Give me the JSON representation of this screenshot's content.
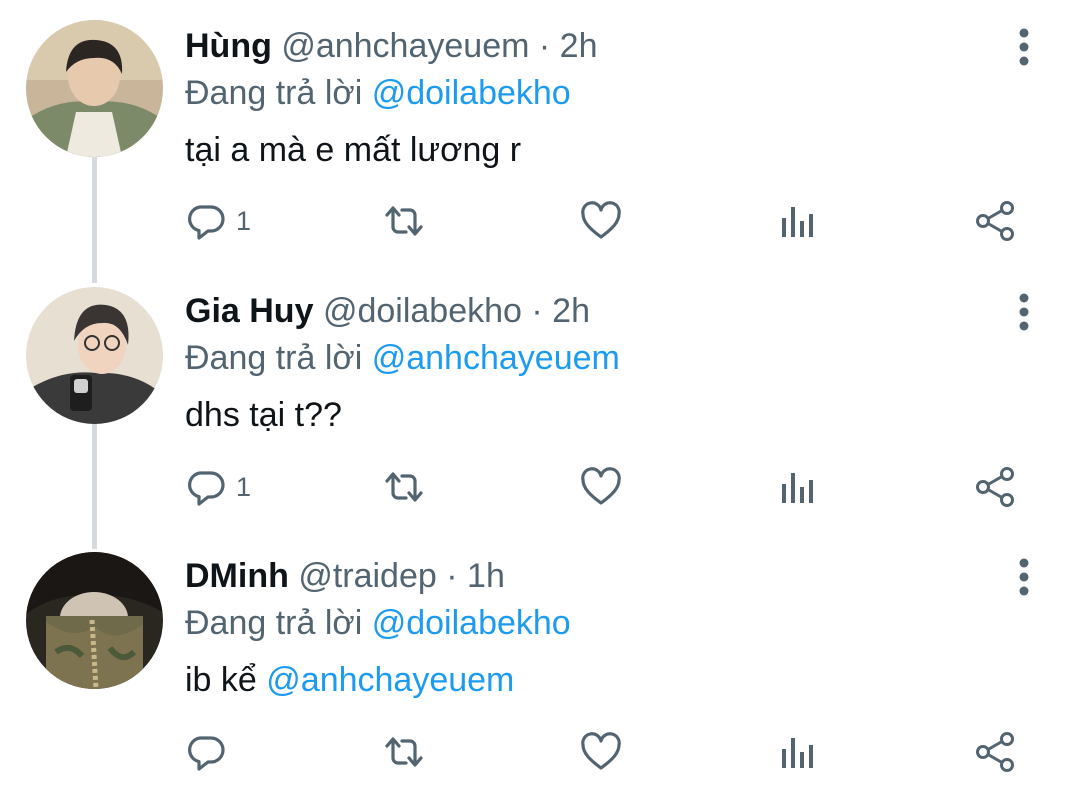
{
  "colors": {
    "accent": "#1d9bf0",
    "secondary_text": "#536471",
    "thread_line": "#d6dadd"
  },
  "tweets": [
    {
      "name": "Hùng",
      "handle": "@anhchayeuem",
      "separator": "·",
      "time": "2h",
      "reply_prefix": "Đang trả lời",
      "reply_to": "@doilabekho",
      "text": "tại a mà e mất lương r",
      "text_mention": "",
      "reply_count": "1",
      "icons": [
        "reply-icon",
        "retweet-icon",
        "like-icon",
        "analytics-icon",
        "share-icon",
        "more-icon"
      ]
    },
    {
      "name": "Gia Huy",
      "handle": "@doilabekho",
      "separator": "·",
      "time": "2h",
      "reply_prefix": "Đang trả lời",
      "reply_to": "@anhchayeuem",
      "text": "dhs tại t??",
      "text_mention": "",
      "reply_count": "1",
      "icons": [
        "reply-icon",
        "retweet-icon",
        "like-icon",
        "analytics-icon",
        "share-icon",
        "more-icon"
      ]
    },
    {
      "name": "DMinh",
      "handle": "@traidep",
      "separator": "·",
      "time": "1h",
      "reply_prefix": "Đang trả lời",
      "reply_to": "@doilabekho",
      "text": "ib kể ",
      "text_mention": "@anhchayeuem",
      "reply_count": "",
      "icons": [
        "reply-icon",
        "retweet-icon",
        "like-icon",
        "analytics-icon",
        "share-icon",
        "more-icon"
      ]
    }
  ]
}
